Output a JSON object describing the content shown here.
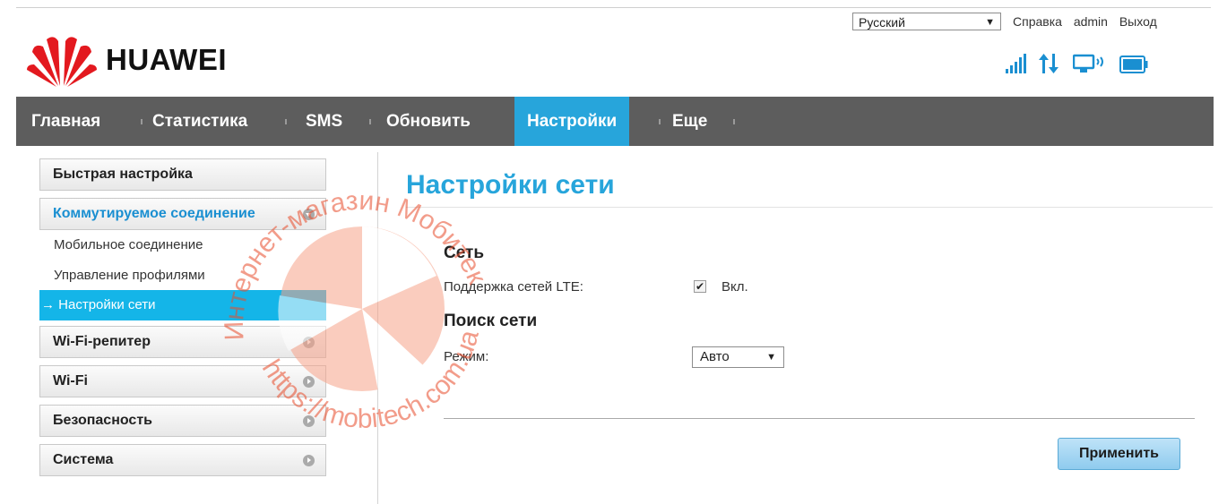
{
  "brand": {
    "logo_text": "HUAWEI"
  },
  "header": {
    "language": "Русский",
    "links": {
      "help": "Справка",
      "user": "admin",
      "logout": "Выход"
    },
    "status_icons": [
      "signal-strength-icon",
      "data-transfer-icon",
      "pc-connected-icon",
      "battery-icon"
    ],
    "icon_color": "#1a8fd1"
  },
  "nav": {
    "items": [
      "Главная",
      "Статистика",
      "SMS",
      "Обновить",
      "Настройки",
      "Еще"
    ],
    "active": "Настройки",
    "active_color": "#27a5db"
  },
  "sidebar": {
    "quick_setup": "Быстрая настройка",
    "dialup": "Коммутируемое соединение",
    "sub_items": [
      "Мобильное соединение",
      "Управление профилями",
      "→ Настройки сети"
    ],
    "wifi_repeater": "Wi-Fi-репитер",
    "wifi": "Wi-Fi",
    "security": "Безопасность",
    "system": "Система"
  },
  "main": {
    "title": "Настройки сети",
    "network_section": "Сеть",
    "lte_label": "Поддержка сетей LTE:",
    "lte_checked": true,
    "lte_value": "Вкл.",
    "search_section": "Поиск сети",
    "mode_label": "Режим:",
    "mode_value": "Авто",
    "apply": "Применить"
  },
  "watermark": {
    "text_arc": "Интернет-магазин Мобитек",
    "url": "https://mobitech.com.ua"
  }
}
